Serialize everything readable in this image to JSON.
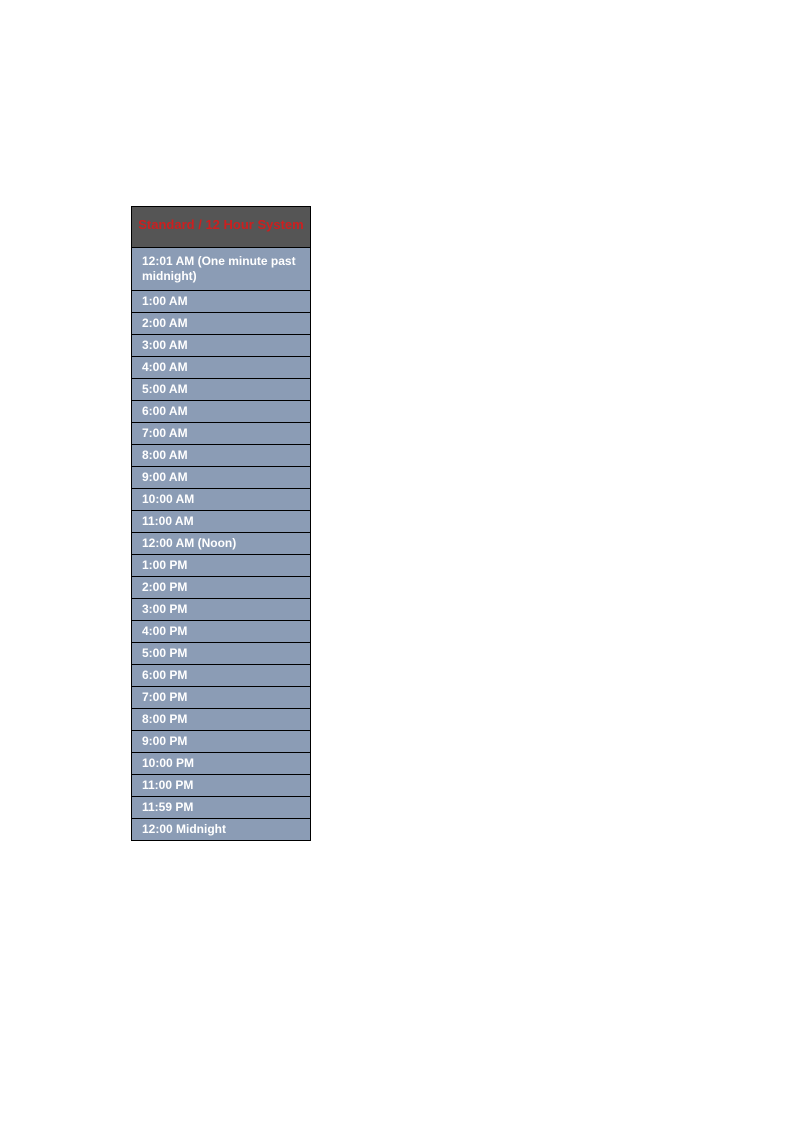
{
  "table": {
    "header": "Standard / 12 Hour System",
    "rows": [
      "12:01 AM (One minute past midnight)",
      "1:00 AM",
      "2:00 AM",
      "3:00 AM",
      "4:00 AM",
      "5:00 AM",
      "6:00 AM",
      "7:00 AM",
      "8:00 AM",
      "9:00 AM",
      "10:00 AM",
      "11:00 AM",
      "12:00 AM (Noon)",
      "1:00 PM",
      "2:00 PM",
      "3:00 PM",
      "4:00 PM",
      "5:00 PM",
      "6:00 PM",
      "7:00 PM",
      "8:00 PM",
      "9:00 PM",
      "10:00 PM",
      "11:00 PM",
      "11:59 PM",
      "12:00 Midnight"
    ]
  }
}
